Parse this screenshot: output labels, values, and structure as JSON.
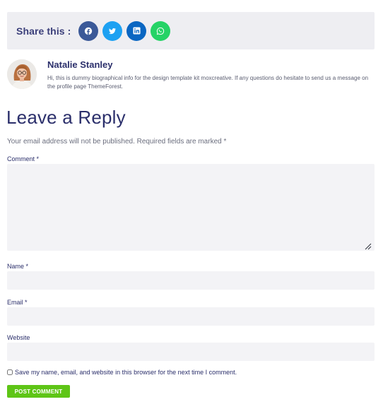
{
  "share": {
    "label": "Share this :",
    "buttons": [
      {
        "network": "facebook",
        "icon": "facebook-icon",
        "color": "#3b5998"
      },
      {
        "network": "twitter",
        "icon": "twitter-icon",
        "color": "#1da1f2"
      },
      {
        "network": "linkedin",
        "icon": "linkedin-icon",
        "color": "#0a66c2"
      },
      {
        "network": "whatsapp",
        "icon": "whatsapp-icon",
        "color": "#25d366"
      }
    ]
  },
  "author": {
    "name": "Natalie Stanley",
    "bio": "Hi, this is dummy biographical info for the design template kit moxcreative. If any questions do hesitate to send us a message on the profile page ThemeForest."
  },
  "reply": {
    "title": "Leave a Reply",
    "notes": "Your email address will not be published. Required fields are marked *",
    "comment_label": "Comment *",
    "comment_value": "",
    "name_label": "Name *",
    "name_value": "",
    "email_label": "Email *",
    "email_value": "",
    "website_label": "Website",
    "website_value": "",
    "consent_label": "Save my name, email, and website in this browser for the next time I comment.",
    "consent_checked": false,
    "submit_label": "POST COMMENT"
  },
  "colors": {
    "heading": "#2b2f6b",
    "field_bg": "#f3f3f6",
    "share_bar_bg": "#eeeef2",
    "submit_bg": "#5ec516"
  }
}
